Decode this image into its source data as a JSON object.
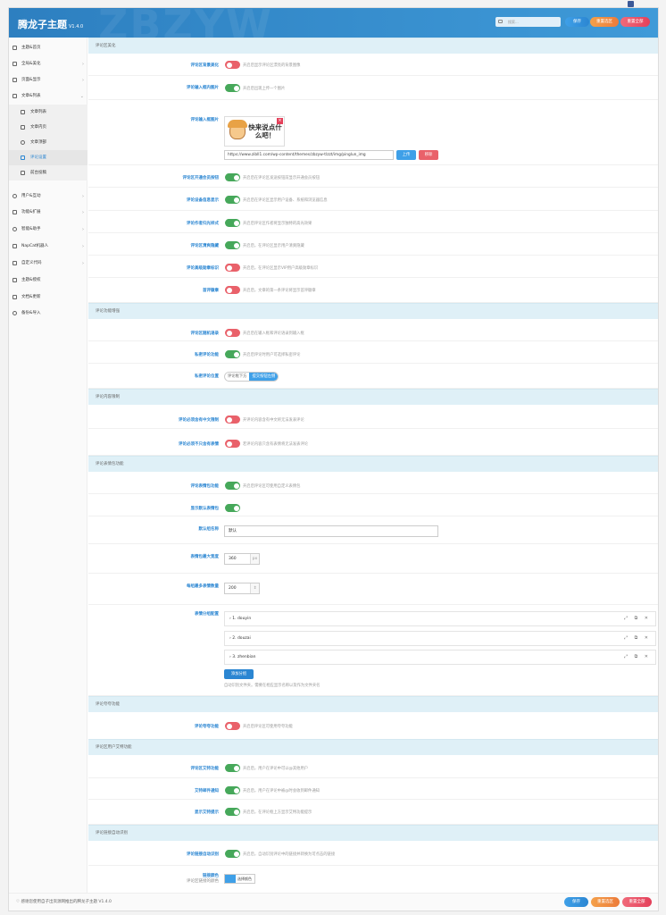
{
  "header": {
    "brand": "腾龙子主题",
    "version": "V1.4.0",
    "watermark": "ZBZYW",
    "search_placeholder": "搜索...",
    "save": "保存",
    "reset_section": "重置选区",
    "reset_all": "重置全部"
  },
  "sidebar": [
    {
      "label": "主题&首页",
      "icon": "home-icon",
      "chev": ""
    },
    {
      "label": "全局&美化",
      "icon": "globe-icon",
      "chev": "›"
    },
    {
      "label": "页面&显示",
      "icon": "page-icon",
      "chev": "›"
    },
    {
      "label": "文章&列表",
      "icon": "doc-icon",
      "chev": "⌄"
    },
    {
      "label": "文章列表",
      "icon": "list-icon",
      "chev": ""
    },
    {
      "label": "文章内页",
      "icon": "file-icon",
      "chev": ""
    },
    {
      "label": "文章顶部",
      "icon": "info-icon",
      "chev": ""
    },
    {
      "label": "评论设置",
      "icon": "comment-icon",
      "chev": ""
    },
    {
      "label": "前台投稿",
      "icon": "pen-icon",
      "chev": ""
    },
    {
      "label": "用户&互动",
      "icon": "user-icon",
      "chev": "›"
    },
    {
      "label": "功能&扩展",
      "icon": "plug-icon",
      "chev": "›"
    },
    {
      "label": "智能&助手",
      "icon": "bulb-icon",
      "chev": "›"
    },
    {
      "label": "NapCat机器人",
      "icon": "robot-icon",
      "chev": "›"
    },
    {
      "label": "自定义代码",
      "icon": "code-icon",
      "chev": "›"
    },
    {
      "label": "主题&授权",
      "icon": "key-icon",
      "chev": ""
    },
    {
      "label": "文档&更新",
      "icon": "book-icon",
      "chev": ""
    },
    {
      "label": "备份&导入",
      "icon": "backup-icon",
      "chev": ""
    }
  ],
  "sections": {
    "s1": "评论区美化",
    "s2": "评论功能增强",
    "s3": "评论内容限制",
    "s4": "评论表情包功能",
    "s5": "评论夸夸功能",
    "s6": "评论区用户艾特功能",
    "s7": "评论链接自动识别"
  },
  "rows": {
    "r1": {
      "label": "评论区背景美化",
      "desc": "开启后显示评论区漂亮的背景图像"
    },
    "r2": {
      "label": "评论输入框内图片",
      "desc": "开启后出现上传一个图片"
    },
    "r3": {
      "label": "评论输入框图片"
    },
    "r4": {
      "label": "评论区开通会员按钮",
      "desc": "开启后在评论区发送按钮前显示开通会员按钮"
    },
    "r5": {
      "label": "评论设备信息显示",
      "desc": "开启后在评论区显示用户设备、系统和浏览器信息"
    },
    "r6": {
      "label": "评论作者归光样式",
      "desc": "开启后评论区作者将显示独特的高光效果"
    },
    "r7": {
      "label": "评论区清爽隐藏",
      "desc": "开启后，在评论区显示用户清爽隐藏"
    },
    "r8": {
      "label": "评论高级勋章标识",
      "desc": "开启后，在评论区显示VIP用户高级勋章标识"
    },
    "r9": {
      "label": "首评徽章",
      "desc": "开启后，文章的第一条评论将显示首评徽章"
    },
    "r10": {
      "label": "评论区随机语录",
      "desc": "开启后在输入框和评论语录到输入框"
    },
    "r11": {
      "label": "私密评论功能",
      "desc": "开启后评论时用户可选择私密评论"
    },
    "r12": {
      "label": "私密评论位置"
    },
    "r13": {
      "label": "评论必须含有中文限制",
      "desc": "开评论内容含有中文将无法发表评论"
    },
    "r14": {
      "label": "评论必须不只含有表情",
      "desc": "若评论内容只含有表情将无法发表评论"
    },
    "r15": {
      "label": "评论表情包功能",
      "desc": "开启后评论区可使用自定义表情包"
    },
    "r16": {
      "label": "显示默认表情包"
    },
    "r17": {
      "label": "默认组名称"
    },
    "r18": {
      "label": "表情包最大宽度"
    },
    "r19": {
      "label": "每组最多表情数量"
    },
    "r20": {
      "label": "表情分组配置"
    },
    "r21": {
      "label": "评论夸夸功能",
      "desc": "开启后评论区可使用夸夸功能"
    },
    "r22": {
      "label": "评论区艾特功能",
      "desc": "开启后，用户在评论中可以@其他用户"
    },
    "r23": {
      "label": "艾特邮件通知",
      "desc": "开启后，用户在评论中被@时会收到邮件通知"
    },
    "r24": {
      "label": "显示艾特提示",
      "desc": "开启后，在评论框上方显示艾特功能提示"
    },
    "r25": {
      "label": "评论链接自动识别",
      "desc": "开启后，自动识别评论中的链接并转换为可点击的链接"
    },
    "r26": {
      "label": "链接颜色",
      "sublabel": "评论区链接的颜色"
    }
  },
  "comment_image": {
    "text": "快来说点什么吧！",
    "url": "https://www.zibll1.com/wp-content/themes/zbzyw-tlzzt/img/pinglun_img",
    "upload": "上传",
    "remove": "移除"
  },
  "private_position": {
    "opt1": "评论框下方",
    "opt2": "提交按钮左侧"
  },
  "emoji": {
    "default_group": "默认",
    "max_width": "360",
    "width_unit": "px",
    "max_count": "200",
    "groups": [
      "› 1. douyin",
      "› 2. douzai",
      "› 3. zhenbian"
    ],
    "group_tools": "⤢ ⧉ ✕",
    "add_group": "添加分组",
    "hint": "自动识别文件夹。需要在相应显示名称以及作为文件夹名"
  },
  "link_color": {
    "label": "选择颜色",
    "value": "#3fa0e8"
  },
  "footer": {
    "note": "♡ 感谢您使用自子出资源网推出的腾龙子主题 V1.4.0"
  }
}
